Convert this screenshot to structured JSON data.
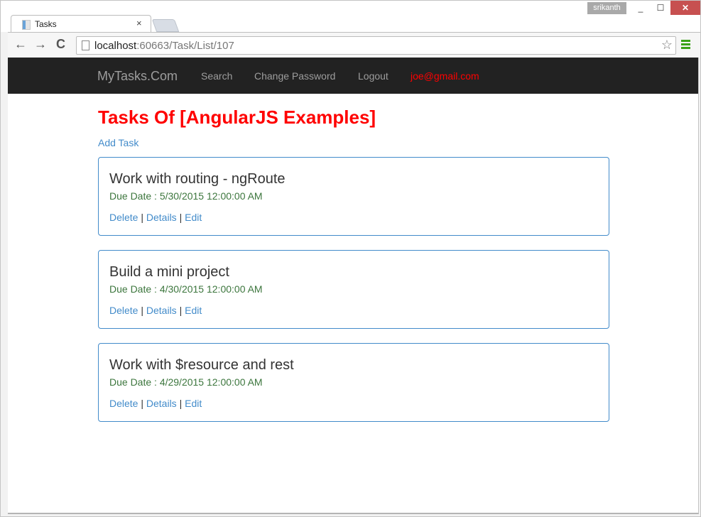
{
  "browser": {
    "user_badge": "srikanth",
    "tab": {
      "title": "Tasks",
      "close": "×"
    },
    "window_buttons": {
      "minimize": "_",
      "maximize": "☐",
      "close": "✕"
    },
    "nav": {
      "back": "←",
      "forward": "→",
      "reload": "C"
    },
    "url_host": "localhost",
    "url_rest": ":60663/Task/List/107",
    "star": "☆"
  },
  "navbar": {
    "brand": "MyTasks.Com",
    "links": [
      "Search",
      "Change Password",
      "Logout"
    ],
    "email": "joe@gmail.com"
  },
  "page": {
    "title": "Tasks Of [AngularJS Examples]",
    "add_task": "Add Task"
  },
  "tasks": [
    {
      "title": "Work with routing - ngRoute",
      "due": "Due Date : 5/30/2015 12:00:00 AM",
      "actions": [
        "Delete",
        "Details",
        "Edit"
      ]
    },
    {
      "title": "Build a mini project",
      "due": "Due Date : 4/30/2015 12:00:00 AM",
      "actions": [
        "Delete",
        "Details",
        "Edit"
      ]
    },
    {
      "title": "Work with $resource and rest",
      "due": "Due Date : 4/29/2015 12:00:00 AM",
      "actions": [
        "Delete",
        "Details",
        "Edit"
      ]
    }
  ],
  "separator": "|",
  "colors": {
    "title": "#ff0000",
    "link": "#428bca",
    "due": "#3c763d",
    "navbar": "#222222",
    "card_border": "#428bca"
  }
}
